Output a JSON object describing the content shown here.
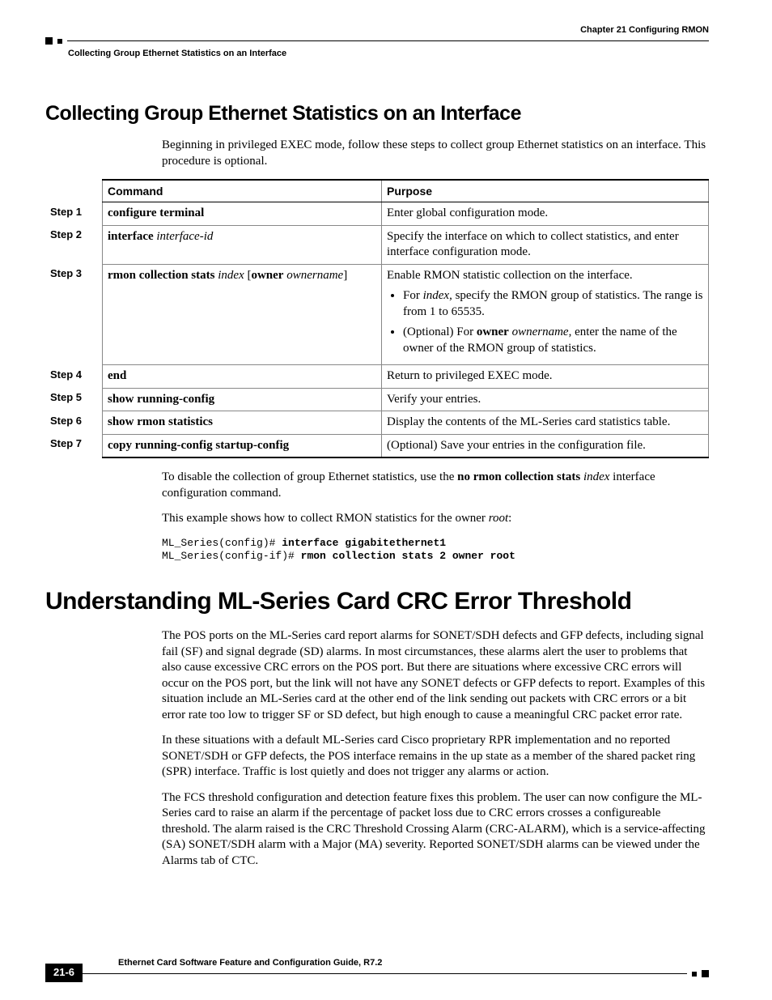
{
  "header": {
    "chapter": "Chapter 21   Configuring RMON",
    "running_head": "Collecting Group Ethernet Statistics on an Interface"
  },
  "section1": {
    "title": "Collecting Group Ethernet Statistics on an Interface",
    "intro": "Beginning in privileged EXEC mode, follow these steps to collect group Ethernet statistics on an interface. This procedure is optional.",
    "table": {
      "headers": {
        "col1": "Command",
        "col2": "Purpose"
      },
      "rows": [
        {
          "step": "Step 1",
          "cmd": {
            "bold1": "configure terminal"
          },
          "purpose_text": "Enter global configuration mode."
        },
        {
          "step": "Step 2",
          "cmd": {
            "bold1": "interface",
            "ital1": "interface-id"
          },
          "purpose_text": "Specify the interface on which to collect statistics, and enter interface configuration mode."
        },
        {
          "step": "Step 3",
          "cmd": {
            "bold1": "rmon collection stats",
            "ital1": "index",
            "plain1": " [",
            "bold2": "owner",
            "ital2": "ownername",
            "plain2": "]"
          },
          "purpose_text": "Enable RMON statistic collection on the interface.",
          "bullets": [
            {
              "pre": "For ",
              "ital": "index",
              "post": ", specify the RMON group of statistics. The range is from 1 to 65535."
            },
            {
              "pre": "(Optional) For ",
              "bold": "owner",
              "ital": "ownername",
              "post": ", enter the name of the owner of the RMON group of statistics."
            }
          ]
        },
        {
          "step": "Step 4",
          "cmd": {
            "bold1": "end"
          },
          "purpose_text": "Return to privileged EXEC mode."
        },
        {
          "step": "Step 5",
          "cmd": {
            "bold1": "show running-config"
          },
          "purpose_text": "Verify your entries."
        },
        {
          "step": "Step 6",
          "cmd": {
            "bold1": "show rmon statistics"
          },
          "purpose_text": "Display the contents of the ML-Series card statistics table."
        },
        {
          "step": "Step 7",
          "cmd": {
            "bold1": "copy running-config startup-config"
          },
          "purpose_text": "(Optional) Save your entries in the configuration file."
        }
      ]
    },
    "after1": {
      "pre": "To disable the collection of group Ethernet statistics, use the ",
      "bold": "no rmon collection stats",
      "ital": "index",
      "post": " interface configuration command."
    },
    "after2": {
      "pre": "This example shows how to collect RMON statistics for the owner ",
      "ital": "root",
      "post": ":"
    },
    "console": {
      "l1a": "ML_Series(config)# ",
      "l1b": "interface gigabitethernet1",
      "l2a": "ML_Series(config-if)# ",
      "l2b": "rmon collection stats 2 owner root"
    }
  },
  "section2": {
    "title": "Understanding ML-Series Card CRC Error Threshold",
    "p1": "The POS ports on the ML-Series card report alarms for SONET/SDH defects and GFP defects, including signal fail (SF) and signal degrade (SD) alarms. In most circumstances, these alarms alert the user to problems that also cause excessive CRC errors on the POS port. But there are situations where excessive CRC errors will occur on the POS port, but the link will not have any SONET defects or GFP defects to report. Examples of this situation include an ML-Series card at the other end of the link sending out packets with CRC errors or a bit error rate too low to trigger SF or SD defect, but high enough to cause a meaningful CRC packet error rate.",
    "p2": "In these situations with a default ML-Series card Cisco proprietary RPR  implementation and no reported SONET/SDH or GFP defects, the POS interface remains in the up state as a member of the shared packet ring (SPR) interface. Traffic is lost quietly and does not trigger any alarms or action.",
    "p3": "The FCS threshold configuration and detection feature fixes this problem. The user can now configure the ML-Series card to raise an alarm if the percentage of packet loss due to CRC errors crosses a configureable threshold. The alarm raised is the CRC Threshold Crossing Alarm (CRC-ALARM), which is a service-affecting (SA) SONET/SDH alarm with a Major (MA) severity. Reported SONET/SDH alarms can be viewed under the Alarms tab of CTC."
  },
  "footer": {
    "title": "Ethernet Card Software Feature and Configuration Guide, R7.2",
    "pagenum": "21-6"
  }
}
